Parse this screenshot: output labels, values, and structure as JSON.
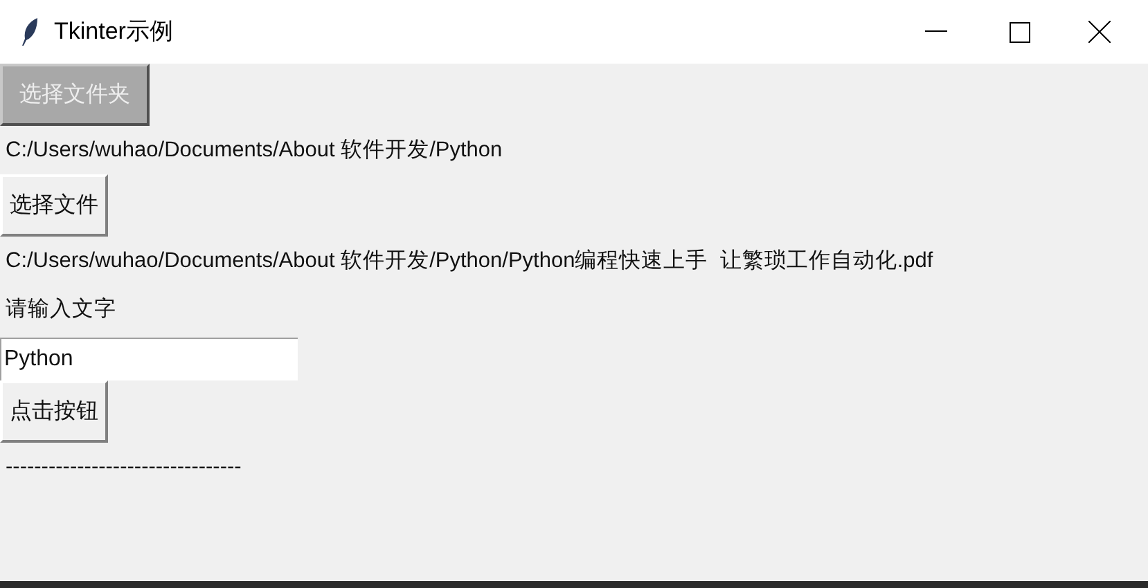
{
  "window": {
    "title": "Tkinter示例"
  },
  "widgets": [
    {
      "kind": "button",
      "label": "选择文件夹",
      "pressed": true
    },
    {
      "kind": "label",
      "text": "C:/Users/wuhao/Documents/About 软件开发/Python"
    },
    {
      "kind": "button",
      "label": "选择文件",
      "pressed": false
    },
    {
      "kind": "label",
      "text": "C:/Users/wuhao/Documents/About 软件开发/Python/Python编程快速上手  让繁琐工作自动化.pdf"
    },
    {
      "kind": "label",
      "text": "请输入文字"
    },
    {
      "kind": "entry",
      "value": "Python"
    },
    {
      "kind": "button",
      "label": "点击按钮",
      "pressed": false
    },
    {
      "kind": "label",
      "text": "---------------------------------"
    }
  ]
}
